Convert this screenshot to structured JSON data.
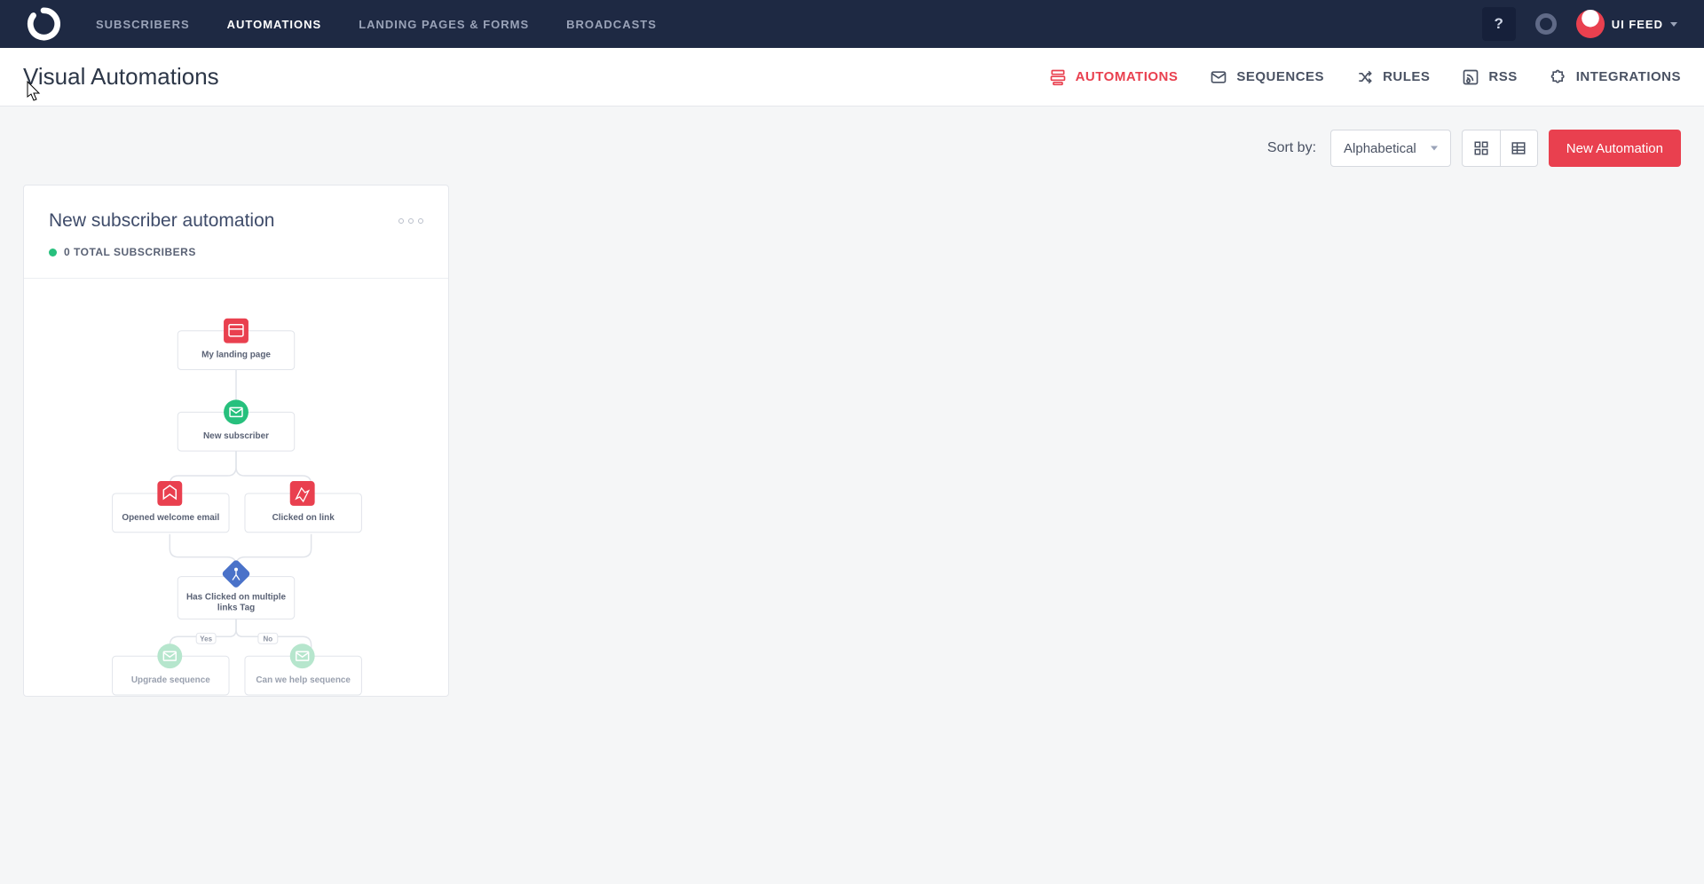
{
  "topnav": {
    "links": [
      {
        "label": "SUBSCRIBERS"
      },
      {
        "label": "AUTOMATIONS"
      },
      {
        "label": "LANDING PAGES & FORMS"
      },
      {
        "label": "BROADCASTS"
      }
    ],
    "help": "?",
    "user_label": "UI FEED"
  },
  "subbar": {
    "title": "Visual Automations",
    "nav": [
      {
        "label": "AUTOMATIONS"
      },
      {
        "label": "SEQUENCES"
      },
      {
        "label": "RULES"
      },
      {
        "label": "RSS"
      },
      {
        "label": "INTEGRATIONS"
      }
    ]
  },
  "toolbar": {
    "sort_label": "Sort by:",
    "sort_value": "Alphabetical",
    "new_button": "New Automation"
  },
  "card": {
    "title": "New subscriber automation",
    "subscribers": "0 TOTAL SUBSCRIBERS",
    "nodes": {
      "landing": "My landing page",
      "newsub": "New subscriber",
      "opened": "Opened welcome email",
      "clicked": "Clicked on link",
      "cond_l1": "Has Clicked on multiple",
      "cond_l2": "links Tag",
      "yes": "Yes",
      "no": "No",
      "upgrade": "Upgrade sequence",
      "help": "Can we help sequence"
    }
  }
}
